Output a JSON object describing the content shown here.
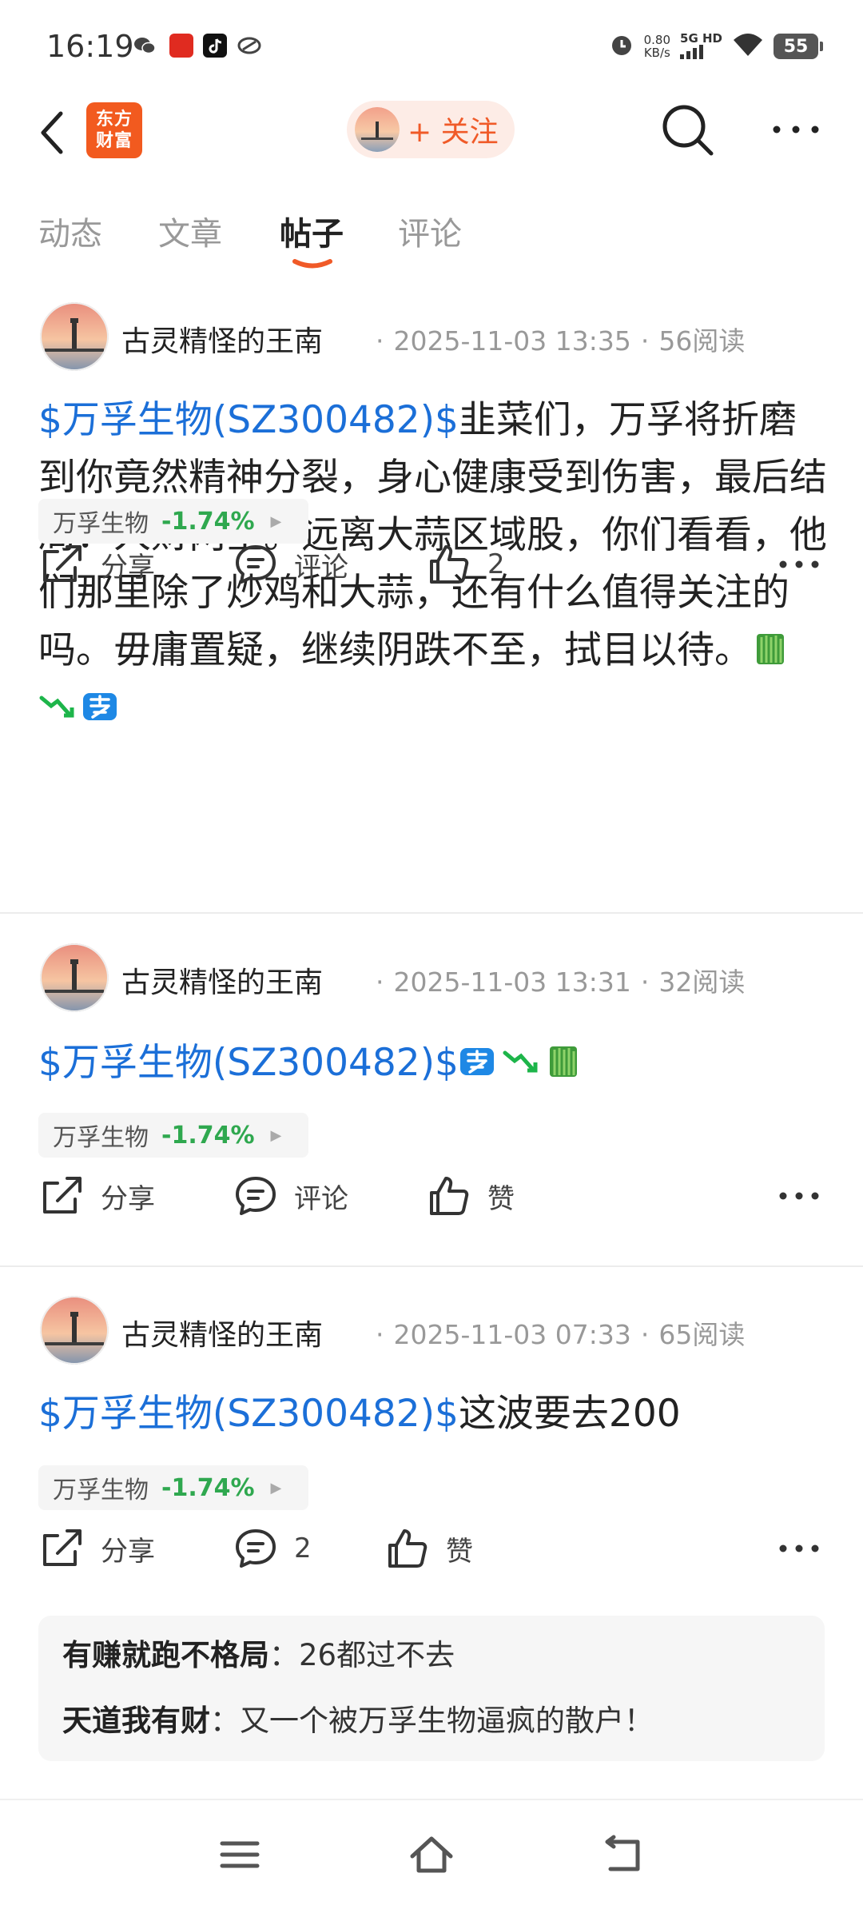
{
  "status_bar": {
    "time": "16:19",
    "speed_value": "0.80",
    "speed_unit": "KB/s",
    "network": "5G HD",
    "battery": "55"
  },
  "header": {
    "logo_line1": "东方",
    "logo_line2": "财富",
    "follow_label": "+ 关注",
    "brand_color": "#f25a1f"
  },
  "tabs": [
    {
      "label": "动态",
      "active": false
    },
    {
      "label": "文章",
      "active": false
    },
    {
      "label": "帖子",
      "active": true
    },
    {
      "label": "评论",
      "active": false
    }
  ],
  "posts": [
    {
      "author": "古灵精怪的王南",
      "datetime": "2025-11-03 13:35",
      "reads": "56阅读",
      "tag": "$万孚生物(SZ300482)$",
      "text": "韭菜们，万孚将折磨到你竟然精神分裂，身心健康受到伤害，最后结局：人财两空。远离大蒜区域股，你们看看，他们那里除了炒鸡和大蒜，还有什么值得关注的吗。毋庸置疑，继续阴跌不至，拭目以待。",
      "emojis": [
        "leek-icon",
        "down-trend-icon",
        "sell-icon"
      ],
      "stock_name": "万孚生物",
      "stock_change": "-1.74%",
      "share_label": "分享",
      "comment_label": "评论",
      "like_label": "2"
    },
    {
      "author": "古灵精怪的王南",
      "datetime": "2025-11-03 13:31",
      "reads": "32阅读",
      "tag": "$万孚生物(SZ300482)$",
      "text": "",
      "emojis": [
        "sell-icon",
        "down-trend-icon",
        "leek-icon"
      ],
      "stock_name": "万孚生物",
      "stock_change": "-1.74%",
      "share_label": "分享",
      "comment_label": "评论",
      "like_label": "赞"
    },
    {
      "author": "古灵精怪的王南",
      "datetime": "2025-11-03 07:33",
      "reads": "65阅读",
      "tag": "$万孚生物(SZ300482)$",
      "text": "这波要去200",
      "emojis": [],
      "stock_name": "万孚生物",
      "stock_change": "-1.74%",
      "share_label": "分享",
      "comment_label": "2",
      "like_label": "赞",
      "comments": [
        {
          "user": "有赚就跑不格局",
          "text": "26都过不去"
        },
        {
          "user": "天道我有财",
          "text": "又一个被万孚生物逼疯的散户！"
        }
      ]
    }
  ],
  "colors": {
    "link": "#1b6fd8",
    "down": "#2fa84f",
    "accent": "#f05a28"
  }
}
